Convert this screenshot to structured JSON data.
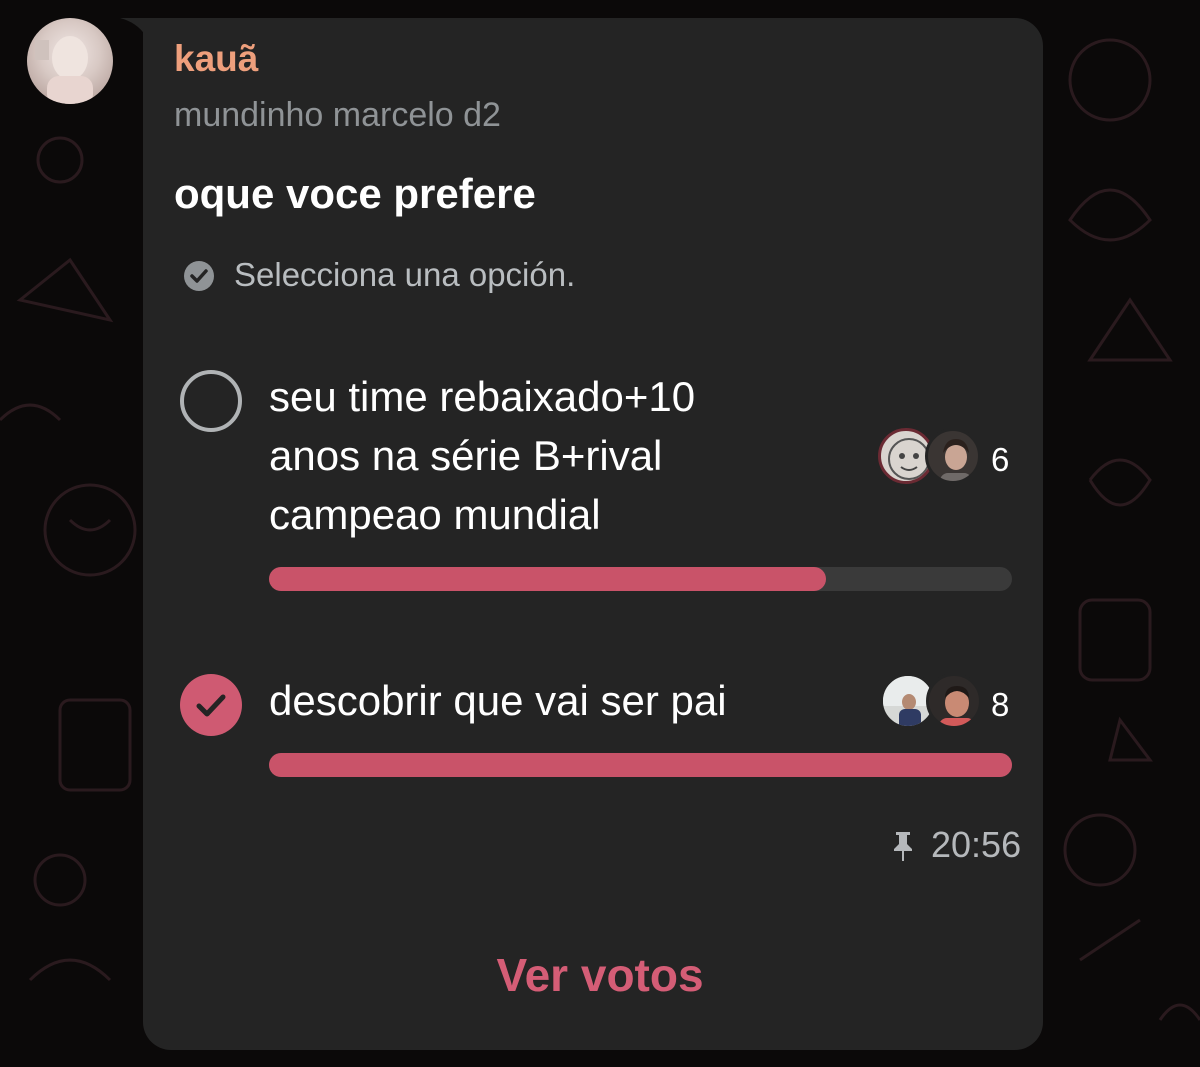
{
  "message": {
    "sender": "kauã",
    "group": "mundinho marcelo d2",
    "time": "20:56"
  },
  "poll": {
    "question": "oque voce prefere",
    "instruction": "Selecciona una opción.",
    "options": [
      {
        "lines": [
          "seu time rebaixado+10",
          "anos na série B+rival",
          "campeao mundial"
        ],
        "votes": "6",
        "fraction": 0.75,
        "selected": false
      },
      {
        "lines": [
          "descobrir que vai ser pai"
        ],
        "votes": "8",
        "fraction": 1.0,
        "selected": true
      }
    ],
    "view_votes_label": "Ver votos"
  },
  "colors": {
    "accent": "#cf5a72",
    "sender": "#ee9f7c",
    "bubble": "#242424"
  },
  "icons": {
    "instruction": "check-circle-icon",
    "pin": "pin-icon",
    "selected": "check-icon"
  }
}
